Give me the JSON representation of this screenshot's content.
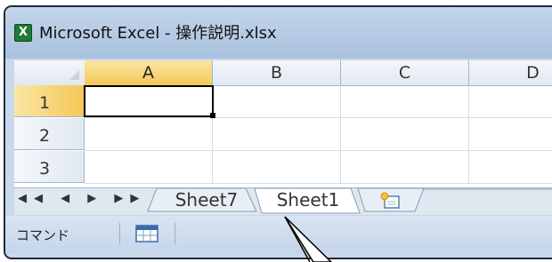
{
  "window": {
    "title": "Microsoft Excel - 操作説明.xlsx",
    "app_icon_glyph": "X"
  },
  "columns": [
    "A",
    "B",
    "C",
    "D"
  ],
  "rows": [
    "1",
    "2",
    "3"
  ],
  "active_cell": "A1",
  "sheet_tabs": {
    "nav_glyphs": "◀◀ ◀ ▶ ▶▶",
    "tabs": [
      {
        "label": "Sheet7",
        "active": false
      },
      {
        "label": "Sheet1",
        "active": true
      }
    ],
    "new_sheet_icon": "insert-worksheet-icon"
  },
  "status_bar": {
    "mode": "コマンド",
    "icon": "normal-view-icon"
  },
  "colors": {
    "selected_header": "#f4c757",
    "title_bar": "#b7cce4",
    "grid_line": "#d4dce6"
  }
}
